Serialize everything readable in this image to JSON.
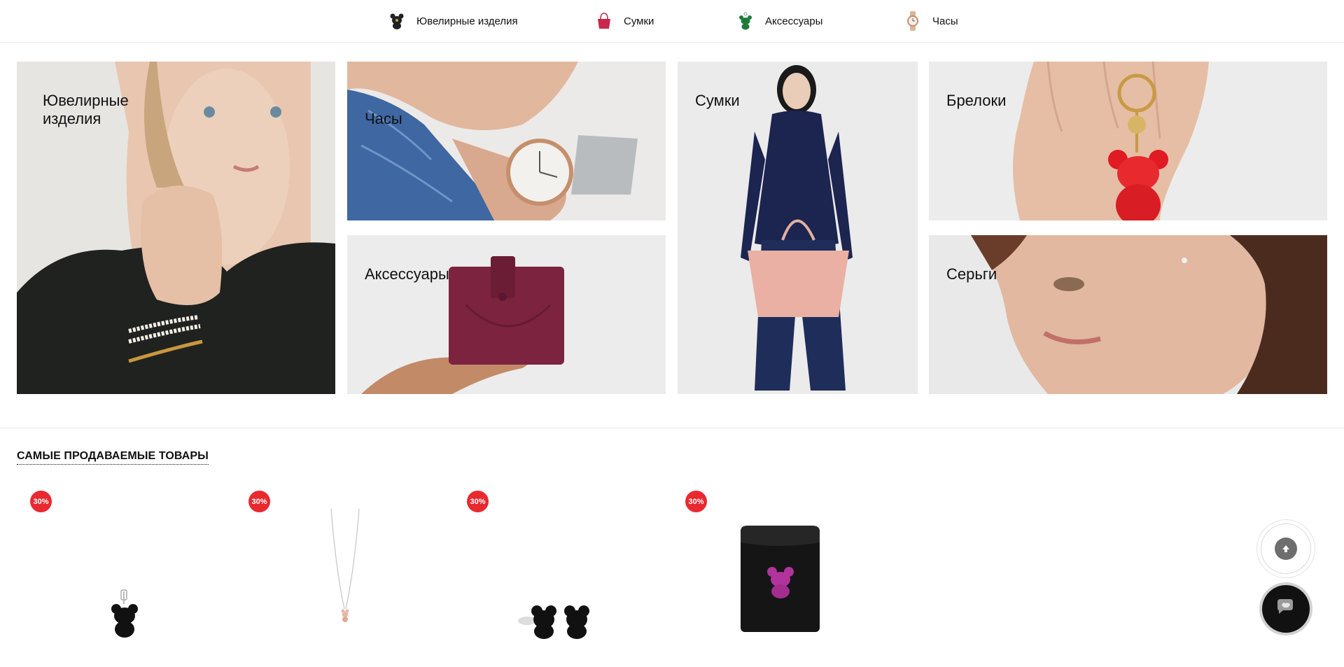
{
  "nav": {
    "items": [
      {
        "label": "Ювелирные изделия",
        "icon": "bear-jewelry-icon"
      },
      {
        "label": "Сумки",
        "icon": "handbag-icon"
      },
      {
        "label": "Аксессуары",
        "icon": "bear-accessory-icon"
      },
      {
        "label": "Часы",
        "icon": "watch-icon"
      }
    ]
  },
  "mosaic": {
    "jewelry": {
      "label_line1": "Ювелирные",
      "label_line2": "изделия"
    },
    "watches": {
      "label": "Часы"
    },
    "accessories": {
      "label": "Аксессуары"
    },
    "bags": {
      "label": "Сумки"
    },
    "keychains": {
      "label": "Брелоки"
    },
    "earrings": {
      "label": "Серьги"
    }
  },
  "bestsellers": {
    "title": "САМЫЕ ПРОДАВАЕМЫЕ ТОВАРЫ",
    "products": [
      {
        "badge": "30%",
        "image": "black-bear-pendant"
      },
      {
        "badge": "30%",
        "image": "pink-bear-necklace"
      },
      {
        "badge": "30%",
        "image": "black-bear-earrings"
      },
      {
        "badge": "30%",
        "image": "black-card-holder-pink-bear"
      }
    ]
  },
  "floating": {
    "scroll_top_icon": "arrow-up-icon",
    "chat_icon": "chat-icon"
  },
  "colors": {
    "badge": "#e8292f",
    "tile_background": "#ededed"
  }
}
